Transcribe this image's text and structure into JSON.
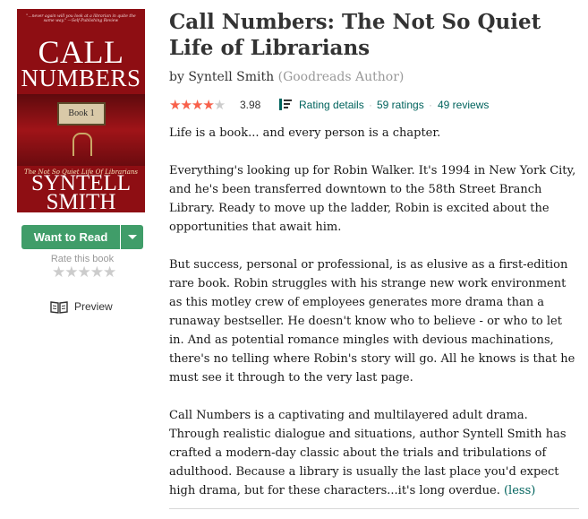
{
  "cover": {
    "blurb": "\"...never again will you look at a librarian in quite the same way.\" —Self-Publishing Review",
    "title_line1": "CALL",
    "title_line2": "NUMBERS",
    "plate": "Book 1",
    "subtitle": "The Not So Quiet Life Of Librarians",
    "author_line1": "SYNTELL",
    "author_line2": "SMITH"
  },
  "actions": {
    "want_to_read": "Want to Read",
    "rate_label": "Rate this book",
    "rate_stars": "★★★★★",
    "preview": "Preview"
  },
  "book": {
    "title": "Call Numbers: The Not So Quiet Life of Librarians",
    "by": "by ",
    "author": "Syntell Smith",
    "author_badge": "(Goodreads Author)",
    "rating_stars": "★★★★★",
    "rating_value": 3.98,
    "average": "3.98",
    "rating_details": "Rating details",
    "ratings_count": "59 ratings",
    "reviews_count": "49 reviews",
    "separator": "·"
  },
  "description": {
    "p1": "Life is a book... and every person is a chapter.",
    "p2": "Everything's looking up for Robin Walker. It's 1994 in New York City, and he's been transferred downtown to the 58th Street Branch Library. Ready to move up the ladder, Robin is excited about the opportunities that await him.",
    "p3": "But success, personal or professional, is as elusive as a first-edition rare book. Robin struggles with his strange new work environment as this motley crew of employees generates more drama than a runaway bestseller. He doesn't know who to believe - or who to let in. And as potential romance mingles with devious machinations, there's no telling where Robin's story will go. All he knows is that he must see it through to the very last page.",
    "p4": "Call Numbers is a captivating and multilayered adult drama. Through realistic dialogue and situations, author Syntell Smith has crafted a modern-day classic about the trials and tribulations of adulthood. Because a library is usually the last place you'd expect high drama, but for these characters...it's long overdue.",
    "less": "(less)"
  },
  "colors": {
    "star": "#fa604a",
    "star_empty": "#cccccc",
    "accent_green": "#409d69",
    "link": "#00635d"
  },
  "icons": {
    "rating_details": "bar-list-icon",
    "preview": "open-book-icon",
    "dropdown": "caret-down-icon"
  }
}
